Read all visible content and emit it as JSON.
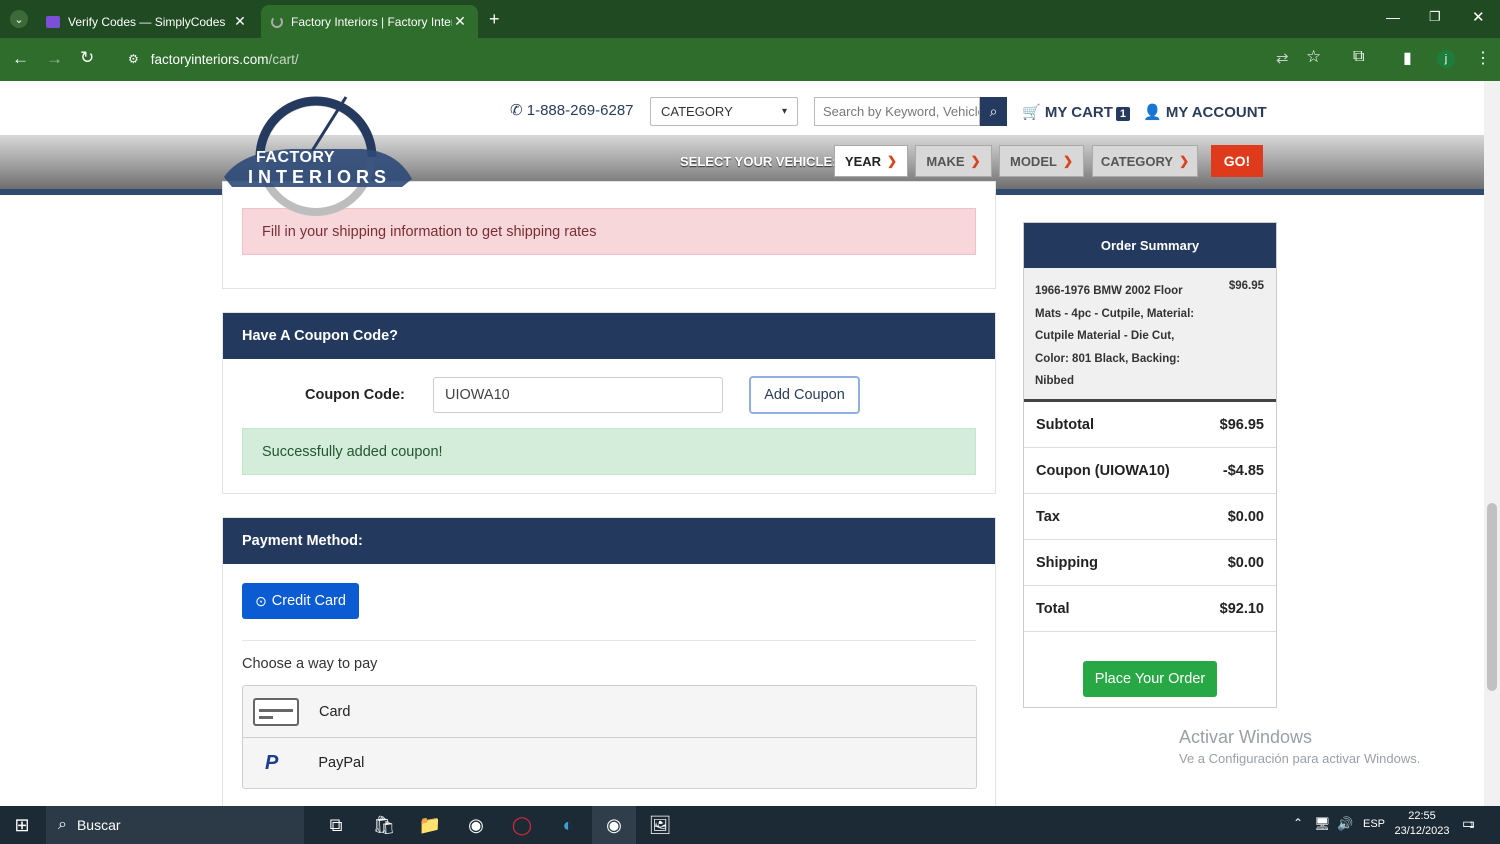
{
  "browser": {
    "tabs": [
      {
        "title": "Verify Codes — SimplyCodes",
        "active": false
      },
      {
        "title": "Factory Interiors | Factory Interi",
        "active": true
      }
    ],
    "url_host": "factoryinteriors.com",
    "url_path": "/cart/"
  },
  "header": {
    "logo_line1": "FACTORY",
    "logo_line2": "INTERIORS",
    "phone": "1-888-269-6287",
    "category_select": "CATEGORY",
    "search_placeholder": "Search by Keyword, Vehicle",
    "my_cart": "MY CART",
    "cart_count": "1",
    "my_account": "MY ACCOUNT",
    "select_vehicle": "SELECT YOUR VEHICLE:",
    "year": "YEAR",
    "make": "MAKE",
    "model": "MODEL",
    "category": "CATEGORY",
    "go": "GO!"
  },
  "shipping": {
    "alert": "Fill in your shipping information to get shipping rates"
  },
  "coupon": {
    "title": "Have A Coupon Code?",
    "label": "Coupon Code:",
    "value": "UIOWA10",
    "button": "Add Coupon",
    "success": "Successfully added coupon!"
  },
  "payment": {
    "title": "Payment Method:",
    "credit_card": "Credit Card",
    "choose": "Choose a way to pay",
    "options": [
      "Card",
      "PayPal"
    ]
  },
  "summary": {
    "title": "Order Summary",
    "item_desc": "1966-1976 BMW 2002 Floor Mats - 4pc - Cutpile, Material: Cutpile Material - Die Cut, Color: 801 Black, Backing: Nibbed",
    "item_price": "$96.95",
    "rows": [
      {
        "label": "Subtotal",
        "value": "$96.95"
      },
      {
        "label": "Coupon (UIOWA10)",
        "value": "-$4.85"
      },
      {
        "label": "Tax",
        "value": "$0.00"
      },
      {
        "label": "Shipping",
        "value": "$0.00"
      },
      {
        "label": "Total",
        "value": "$92.10"
      }
    ],
    "place_order": "Place Your Order"
  },
  "watermark": {
    "line1": "Activar Windows",
    "line2": "Ve a Configuración para activar Windows."
  },
  "taskbar": {
    "search": "Buscar",
    "lang": "ESP",
    "time": "22:55",
    "date": "23/12/2023",
    "notif": "1"
  }
}
